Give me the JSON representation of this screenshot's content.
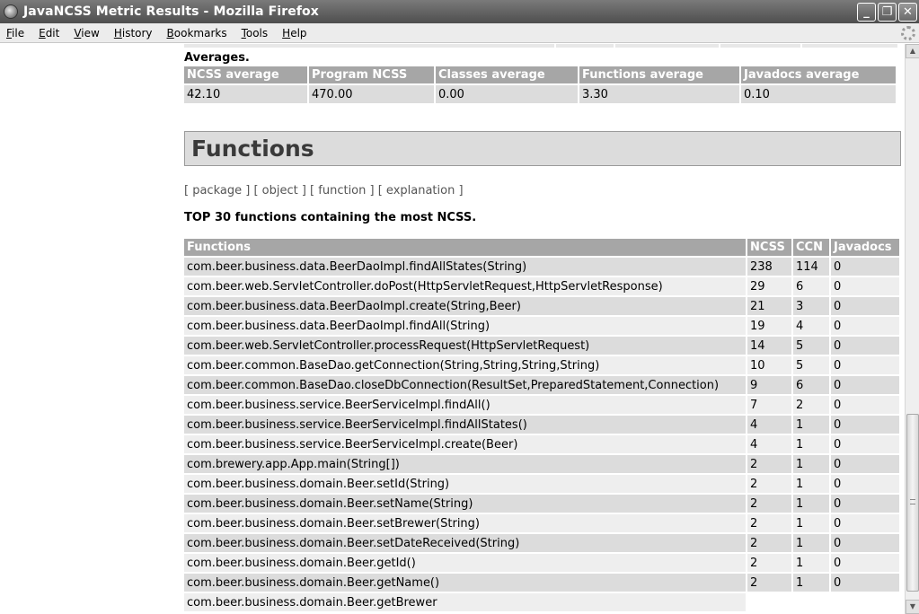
{
  "window": {
    "title": "JavaNCSS Metric Results - Mozilla Firefox",
    "minimize": "_",
    "maximize": "❐",
    "close": "✕"
  },
  "menu": [
    {
      "label": "File",
      "u": "F",
      "rest": "ile"
    },
    {
      "label": "Edit",
      "u": "E",
      "rest": "dit"
    },
    {
      "label": "View",
      "u": "V",
      "rest": "iew"
    },
    {
      "label": "History",
      "u": "H",
      "rest": "istory"
    },
    {
      "label": "Bookmarks",
      "u": "B",
      "rest": "ookmarks"
    },
    {
      "label": "Tools",
      "u": "T",
      "rest": "ools"
    },
    {
      "label": "Help",
      "u": "H",
      "rest": "elp"
    }
  ],
  "averages": {
    "label": "Averages.",
    "headers": [
      "NCSS average",
      "Program NCSS",
      "Classes average",
      "Functions average",
      "Javadocs average"
    ],
    "values": [
      "42.10",
      "470.00",
      "0.00",
      "3.30",
      "0.10"
    ]
  },
  "functions_section": {
    "heading": "Functions",
    "nav": {
      "package": "package",
      "object": "object",
      "function": "function",
      "explanation": "explanation"
    },
    "top_caption": "TOP 30 functions containing the most NCSS.",
    "headers": [
      "Functions",
      "NCSS",
      "CCN",
      "Javadocs"
    ],
    "rows": [
      [
        "com.beer.business.data.BeerDaoImpl.findAllStates(String)",
        "238",
        "114",
        "0"
      ],
      [
        "com.beer.web.ServletController.doPost(HttpServletRequest,HttpServletResponse)",
        "29",
        "6",
        "0"
      ],
      [
        "com.beer.business.data.BeerDaoImpl.create(String,Beer)",
        "21",
        "3",
        "0"
      ],
      [
        "com.beer.business.data.BeerDaoImpl.findAll(String)",
        "19",
        "4",
        "0"
      ],
      [
        "com.beer.web.ServletController.processRequest(HttpServletRequest)",
        "14",
        "5",
        "0"
      ],
      [
        "com.beer.common.BaseDao.getConnection(String,String,String,String)",
        "10",
        "5",
        "0"
      ],
      [
        "com.beer.common.BaseDao.closeDbConnection(ResultSet,PreparedStatement,Connection)",
        "9",
        "6",
        "0"
      ],
      [
        "com.beer.business.service.BeerServiceImpl.findAll()",
        "7",
        "2",
        "0"
      ],
      [
        "com.beer.business.service.BeerServiceImpl.findAllStates()",
        "4",
        "1",
        "0"
      ],
      [
        "com.beer.business.service.BeerServiceImpl.create(Beer)",
        "4",
        "1",
        "0"
      ],
      [
        "com.brewery.app.App.main(String[])",
        "2",
        "1",
        "0"
      ],
      [
        "com.beer.business.domain.Beer.setId(String)",
        "2",
        "1",
        "0"
      ],
      [
        "com.beer.business.domain.Beer.setName(String)",
        "2",
        "1",
        "0"
      ],
      [
        "com.beer.business.domain.Beer.setBrewer(String)",
        "2",
        "1",
        "0"
      ],
      [
        "com.beer.business.domain.Beer.setDateReceived(String)",
        "2",
        "1",
        "0"
      ],
      [
        "com.beer.business.domain.Beer.getId()",
        "2",
        "1",
        "0"
      ],
      [
        "com.beer.business.domain.Beer.getName()",
        "2",
        "1",
        "0"
      ]
    ],
    "partial_row": "com.beer.business.domain.Beer.getBrewer"
  }
}
